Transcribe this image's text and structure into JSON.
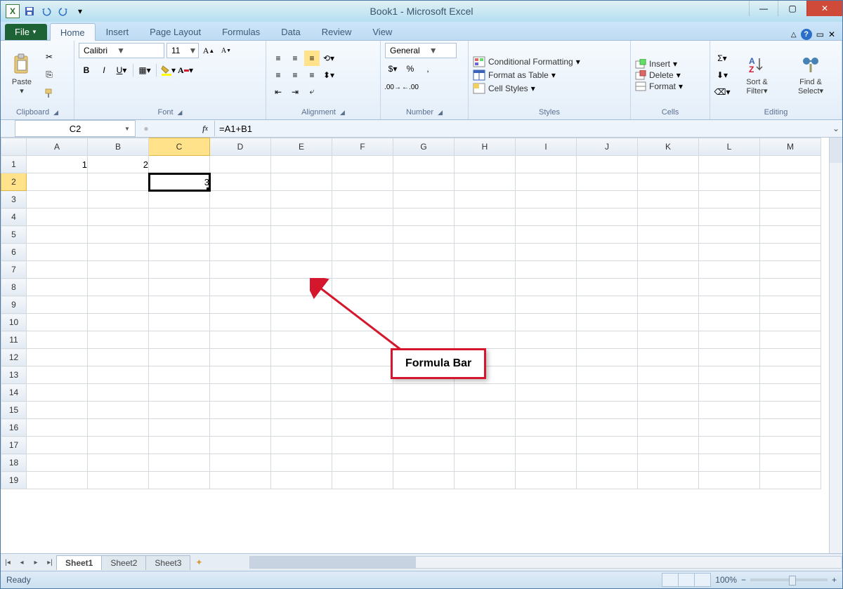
{
  "title": "Book1 - Microsoft Excel",
  "tabs": {
    "file": "File",
    "home": "Home",
    "insert": "Insert",
    "pageLayout": "Page Layout",
    "formulas": "Formulas",
    "data": "Data",
    "review": "Review",
    "view": "View"
  },
  "ribbon": {
    "clipboard": {
      "paste": "Paste",
      "label": "Clipboard"
    },
    "font": {
      "name": "Calibri",
      "size": "11",
      "label": "Font"
    },
    "alignment": {
      "label": "Alignment"
    },
    "number": {
      "format": "General",
      "label": "Number"
    },
    "styles": {
      "cf": "Conditional Formatting",
      "fat": "Format as Table",
      "cs": "Cell Styles",
      "label": "Styles"
    },
    "cells": {
      "insert": "Insert",
      "delete": "Delete",
      "format": "Format",
      "label": "Cells"
    },
    "editing": {
      "sort": "Sort & Filter",
      "find": "Find & Select",
      "label": "Editing"
    }
  },
  "nameBox": "C2",
  "formula": "=A1+B1",
  "columns": [
    "A",
    "B",
    "C",
    "D",
    "E",
    "F",
    "G",
    "H",
    "I",
    "J",
    "K",
    "L",
    "M"
  ],
  "rows": [
    "1",
    "2",
    "3",
    "4",
    "5",
    "6",
    "7",
    "8",
    "9",
    "10",
    "11",
    "12",
    "13",
    "14",
    "15",
    "16",
    "17",
    "18",
    "19"
  ],
  "cells": {
    "A1": "1",
    "B1": "2",
    "C2": "3"
  },
  "selected": "C2",
  "selectedRow": "2",
  "selectedCol": "C",
  "sheets": [
    "Sheet1",
    "Sheet2",
    "Sheet3"
  ],
  "status": "Ready",
  "zoom": "100%",
  "annotation": "Formula Bar"
}
